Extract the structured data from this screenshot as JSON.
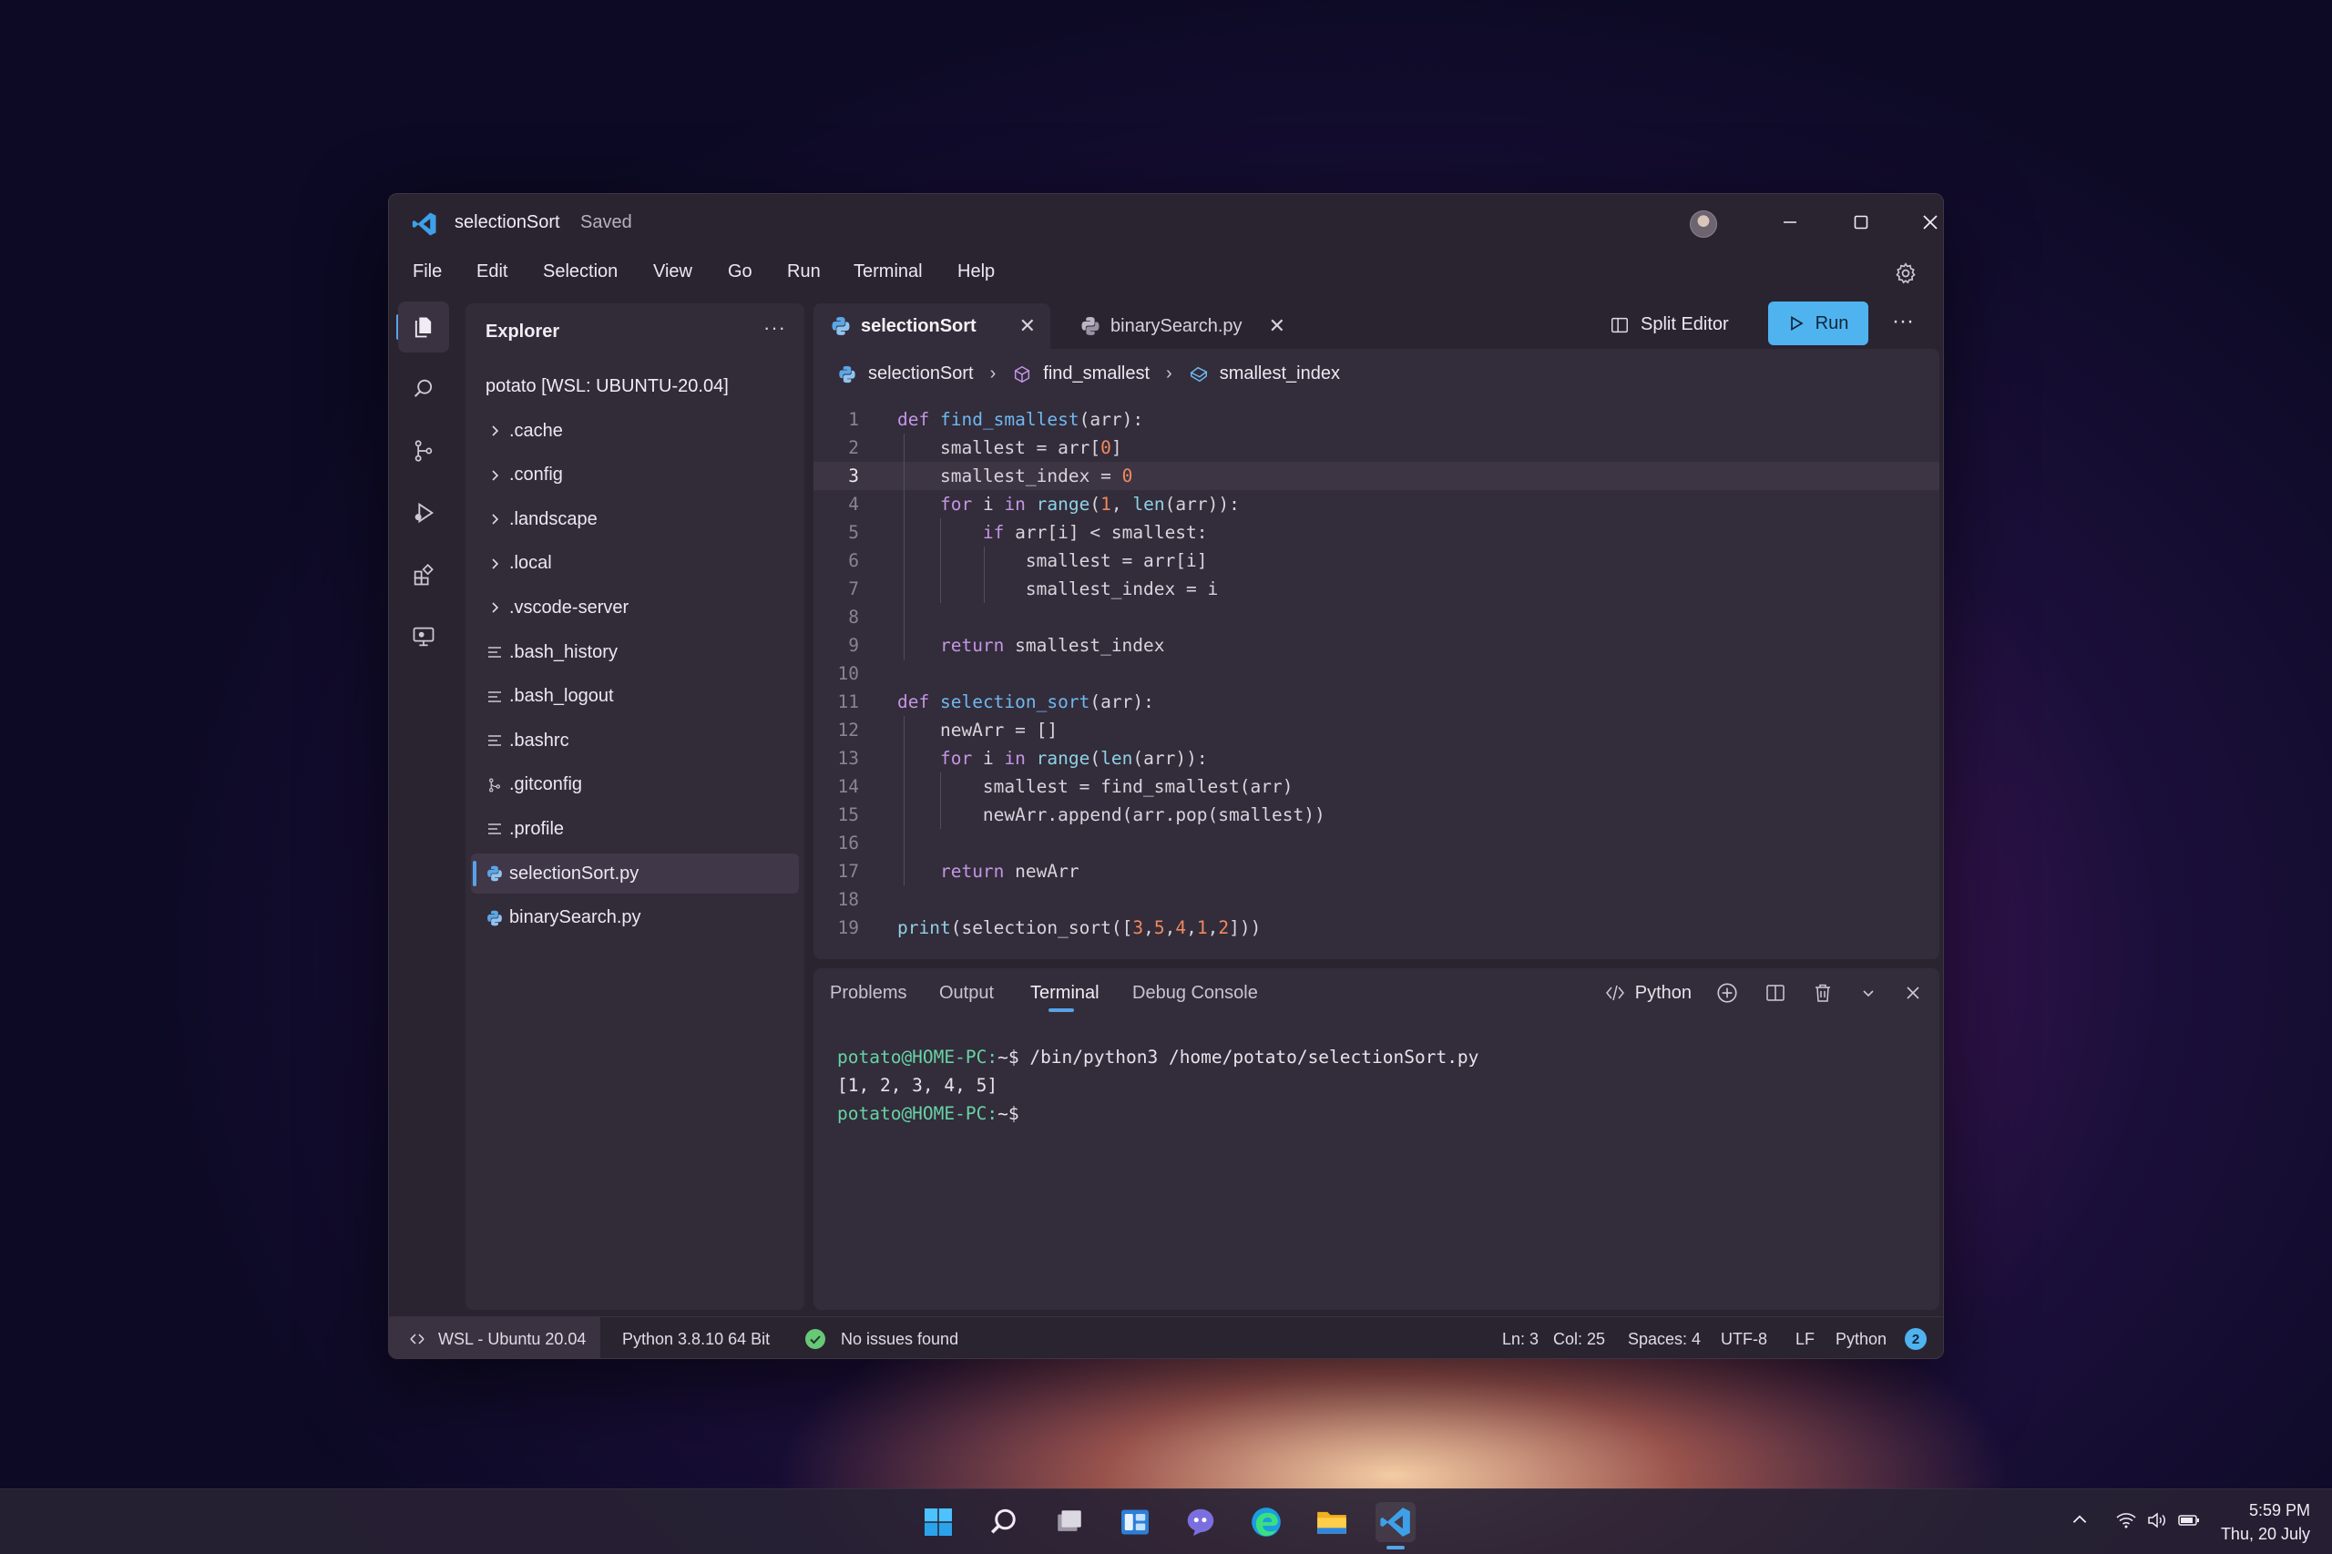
{
  "window": {
    "title": "selectionSort",
    "saved_label": "Saved",
    "window_controls": [
      "minimize-icon",
      "maximize-icon",
      "close-icon"
    ]
  },
  "menu": {
    "items": [
      "File",
      "Edit",
      "Selection",
      "View",
      "Go",
      "Run",
      "Terminal",
      "Help"
    ]
  },
  "activity_bar": {
    "icons": [
      "files-icon",
      "search-icon",
      "source-control-icon",
      "run-debug-icon",
      "extensions-icon",
      "remote-explorer-icon"
    ]
  },
  "explorer": {
    "title": "Explorer",
    "more_label": "···",
    "root": "potato [WSL: UBUNTU-20.04]",
    "items": [
      {
        "label": ".cache",
        "icon": "chevron-right-icon"
      },
      {
        "label": ".config",
        "icon": "chevron-right-icon"
      },
      {
        "label": ".landscape",
        "icon": "chevron-right-icon"
      },
      {
        "label": ".local",
        "icon": "chevron-right-icon"
      },
      {
        "label": ".vscode-server",
        "icon": "chevron-right-icon"
      },
      {
        "label": ".bash_history",
        "icon": "file-lines-icon"
      },
      {
        "label": ".bash_logout",
        "icon": "file-lines-icon"
      },
      {
        "label": ".bashrc",
        "icon": "file-lines-icon"
      },
      {
        "label": ".gitconfig",
        "icon": "git-icon"
      },
      {
        "label": ".profile",
        "icon": "file-lines-icon"
      },
      {
        "label": "selectionSort.py",
        "icon": "python-icon"
      },
      {
        "label": "binarySearch.py",
        "icon": "python-icon"
      }
    ]
  },
  "tabs": [
    {
      "label": "selectionSort",
      "close": "✕"
    },
    {
      "label": "binarySearch.py",
      "close": "✕"
    }
  ],
  "editor_actions": {
    "split_label": "Split Editor",
    "run_label": "Run",
    "more_label": "···"
  },
  "breadcrumb": [
    "selectionSort",
    "find_smallest",
    "smallest_index"
  ],
  "code": {
    "current_line": 3,
    "lines": [
      "def find_smallest(arr):",
      "    smallest = arr[0]",
      "    smallest_index = 0",
      "    for i in range(1, len(arr)):",
      "        if arr[i] < smallest:",
      "            smallest = arr[i]",
      "            smallest_index = i",
      "",
      "    return smallest_index",
      "",
      "def selection_sort(arr):",
      "    newArr = []",
      "    for i in range(len(arr)):",
      "        smallest = find_smallest(arr)",
      "        newArr.append(arr.pop(smallest))",
      "",
      "    return newArr",
      "",
      "print(selection_sort([3,5,4,1,2]))"
    ]
  },
  "panel": {
    "tabs": [
      "Problems",
      "Output",
      "Terminal",
      "Debug Console"
    ],
    "active_tab": "Terminal",
    "shell_label": "Python",
    "terminal": [
      {
        "prompt": "potato@HOME-PC:",
        "rest": "~$ /bin/python3 /home/potato/selectionSort.py"
      },
      {
        "prompt": "",
        "rest": "[1, 2, 3, 4, 5]"
      },
      {
        "prompt": "potato@HOME-PC:",
        "rest": "~$"
      }
    ]
  },
  "status_bar": {
    "remote": "WSL - Ubuntu 20.04",
    "interpreter": "Python 3.8.10 64 Bit",
    "issues": "No issues found",
    "ln": "Ln: 3",
    "col": "Col: 25",
    "spaces": "Spaces: 4",
    "encoding": "UTF-8",
    "eol": "LF",
    "language": "Python",
    "notifications": "2"
  },
  "taskbar": {
    "apps": [
      "windows-start-icon",
      "search-icon",
      "task-view-icon",
      "widgets-icon",
      "chat-icon",
      "edge-icon",
      "file-explorer-icon",
      "vscode-icon"
    ],
    "time": "5:59 PM",
    "date": "Thu, 20 July"
  },
  "colors": {
    "accent": "#4fb3ef",
    "prompt_green": "#67d3a4",
    "keyword": "#c396e4",
    "function": "#6fb8f0",
    "number": "#f08a5d"
  }
}
